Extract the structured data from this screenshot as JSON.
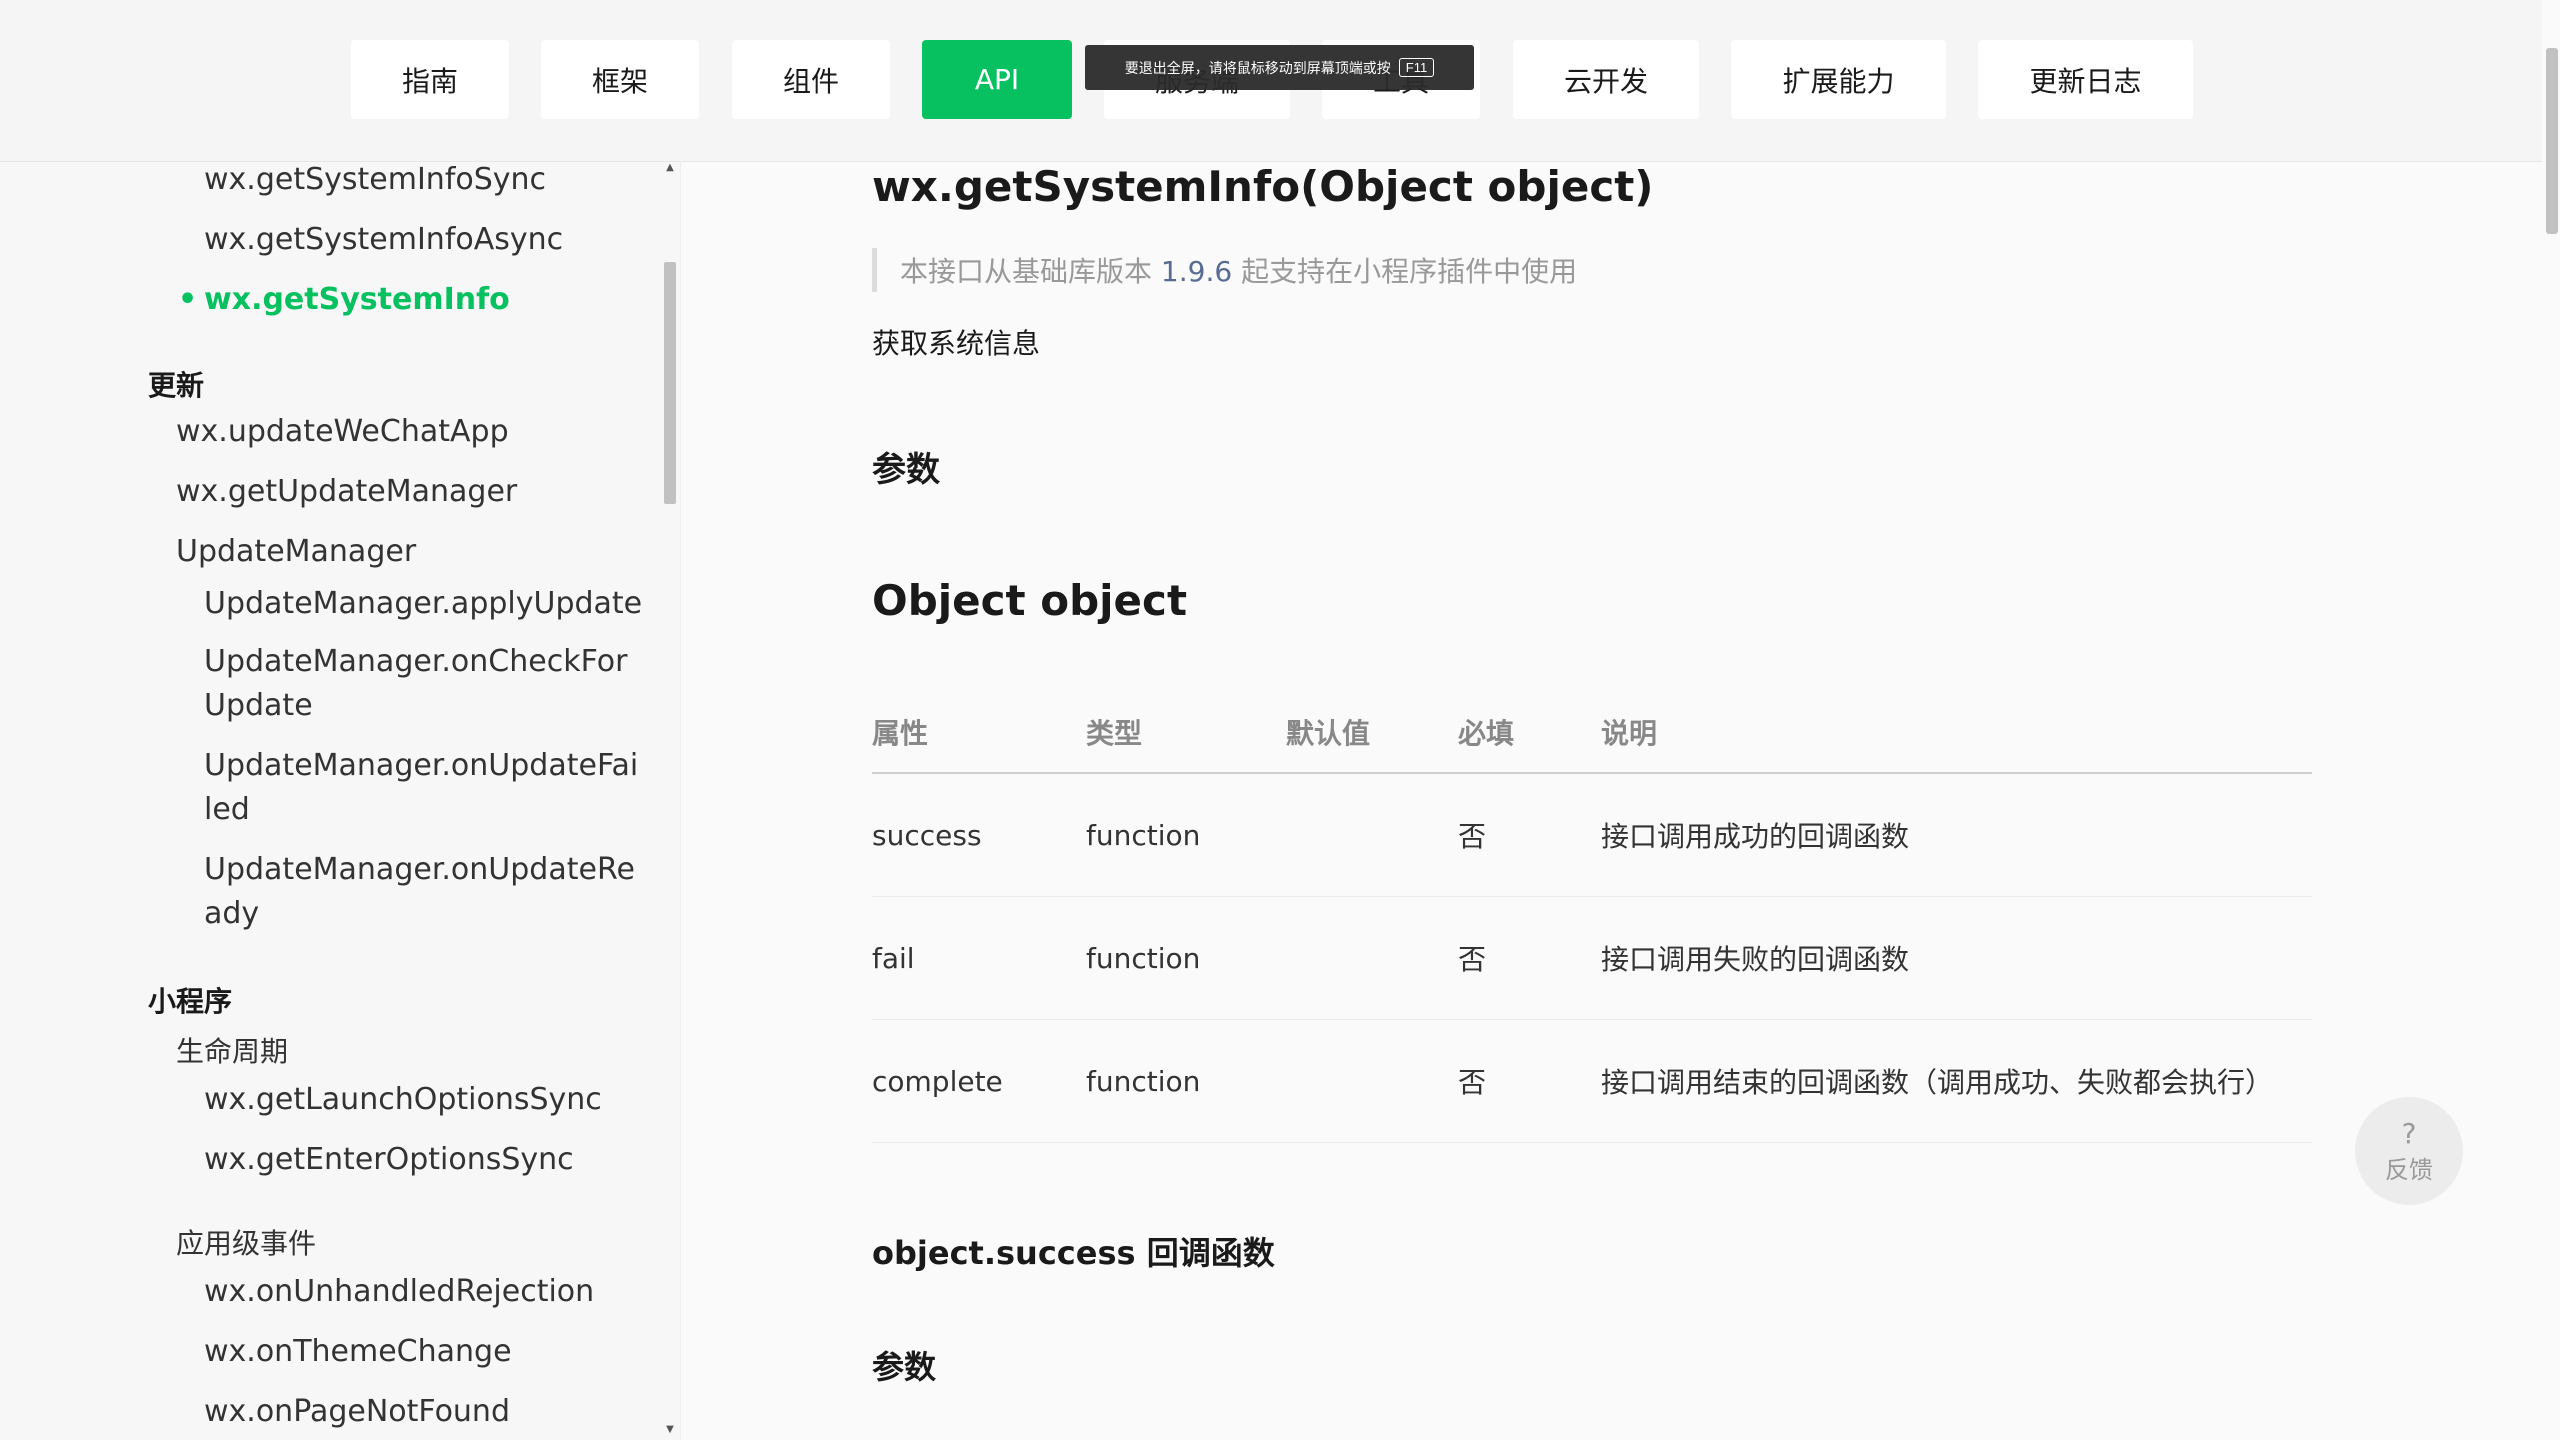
{
  "nav": {
    "items": [
      {
        "label": "指南",
        "active": false
      },
      {
        "label": "框架",
        "active": false
      },
      {
        "label": "组件",
        "active": false
      },
      {
        "label": "API",
        "active": true
      },
      {
        "label": "服务端",
        "active": false
      },
      {
        "label": "工具",
        "active": false
      },
      {
        "label": "云开发",
        "active": false
      },
      {
        "label": "扩展能力",
        "active": false
      },
      {
        "label": "更新日志",
        "active": false
      }
    ],
    "fullscreen_toast": "要退出全屏，请将鼠标移动到屏幕顶端或按",
    "fullscreen_key": "F11"
  },
  "sidebar": {
    "items": [
      "wx.getSystemInfoSync",
      "wx.getSystemInfoAsync",
      "wx.getSystemInfo",
      "更新",
      "wx.updateWeChatApp",
      "wx.getUpdateManager",
      "UpdateManager",
      "UpdateManager.applyUpdate",
      "UpdateManager.onCheckFor Update",
      "UpdateManager.onUpdateFai led",
      "UpdateManager.onUpdateRe ady",
      "小程序",
      "生命周期",
      "wx.getLaunchOptionsSync",
      "wx.getEnterOptionsSync",
      "应用级事件",
      "wx.onUnhandledRejection",
      "wx.onThemeChange",
      "wx.onPageNotFound"
    ],
    "active_index": 2,
    "active_color": "#07c160"
  },
  "main": {
    "title": "wx.getSystemInfo(Object object)",
    "note_prefix": "本接口从基础库版本",
    "note_version": "1.9.6",
    "note_suffix": "起支持在小程序插件中使用",
    "description": "获取系统信息",
    "params_heading": "参数",
    "object_heading": "Object object",
    "table": {
      "headers": [
        "属性",
        "类型",
        "默认值",
        "必填",
        "说明"
      ],
      "rows": [
        [
          "success",
          "function",
          "",
          "否",
          "接口调用成功的回调函数"
        ],
        [
          "fail",
          "function",
          "",
          "否",
          "接口调用失败的回调函数"
        ],
        [
          "complete",
          "function",
          "",
          "否",
          "接口调用结束的回调函数（调用成功、失败都会执行）"
        ]
      ]
    },
    "success_heading": "object.success 回调函数",
    "success_params_heading": "参数"
  },
  "feedback": {
    "icon": "?",
    "label": "反馈"
  },
  "colors": {
    "accent": "#07c160",
    "version_link": "#576b95"
  }
}
